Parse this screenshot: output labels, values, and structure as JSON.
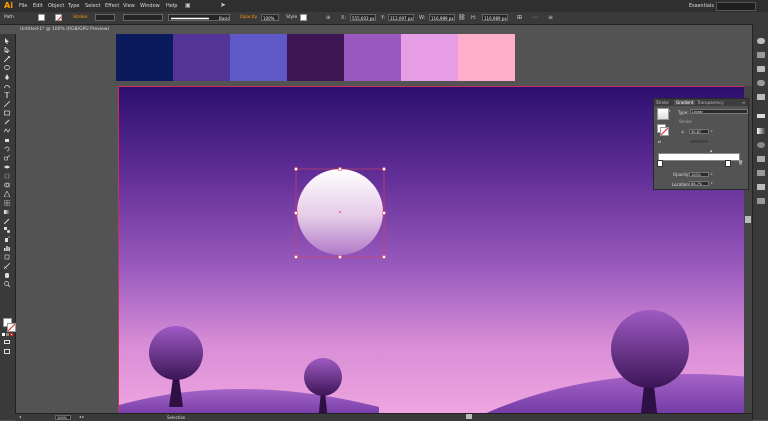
{
  "menubar": {
    "app_logo": "Ai",
    "items": [
      "File",
      "Edit",
      "Object",
      "Type",
      "Select",
      "Effect",
      "View",
      "Window",
      "Help"
    ],
    "workspace": "Essentials"
  },
  "controlbar": {
    "selection_type": "Path",
    "stroke_label": "Stroke",
    "brush_label": "Basic",
    "opacity_label": "Opacity",
    "opacity_value": "100%",
    "style_label": "Style",
    "x_value": "555,603 px",
    "y_value": "312,097 px",
    "w_value": "116,989 px",
    "h_value": "116,989 px"
  },
  "document": {
    "tab_title": "Untitled-1* @ 100% (RGB/GPU Preview)"
  },
  "swatches": {
    "colors": [
      "#0b1a5c",
      "#523597",
      "#5f59c8",
      "#3d1653",
      "#9a59c0",
      "#e89ee6",
      "#ffaec9"
    ]
  },
  "gradient_panel": {
    "tabs": [
      "Stroke",
      "Gradient",
      "Transparency"
    ],
    "type_label": "Type:",
    "type_value": "Linear",
    "stroke_label": "Stroke",
    "angle_value": "90,87",
    "opacity_label": "Opacity:",
    "opacity_value": "100%",
    "location_label": "Location:",
    "location_value": "86,7%"
  },
  "statusbar": {
    "zoom": "100%",
    "mode": "Selection"
  },
  "colors": {
    "accent": "#ff9a00",
    "selection": "#e0405e",
    "sky_top": "#2c0f6e",
    "sky_bottom": "#f0a7e0"
  }
}
